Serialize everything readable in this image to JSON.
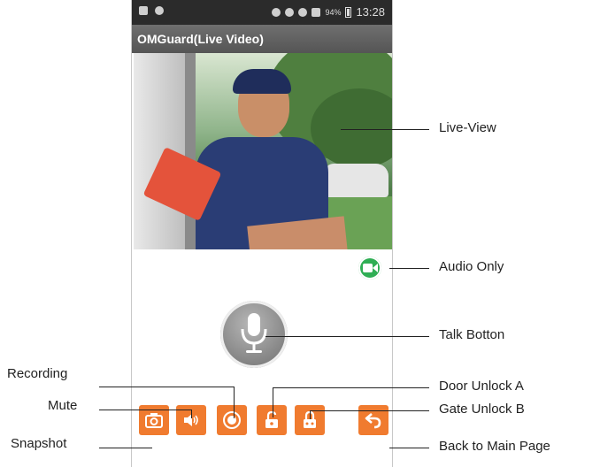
{
  "status_bar": {
    "battery_pct": "94%",
    "time": "13:28"
  },
  "app": {
    "title": "OMGuard(Live Video)"
  },
  "callouts": {
    "live_view": "Live-View",
    "audio_only": "Audio Only",
    "talk": "Talk Botton",
    "door_unlock": "Door Unlock A",
    "gate_unlock": "Gate Unlock B",
    "back": "Back to Main Page",
    "recording": "Recording",
    "mute": "Mute",
    "snapshot": "Snapshot"
  },
  "icons": {
    "audio_only": "video-camera-icon",
    "talk": "microphone-icon",
    "snapshot": "camera-icon",
    "mute": "speaker-icon",
    "recording": "record-icon",
    "door_unlock": "unlock-icon",
    "gate_unlock": "lock-icon",
    "back": "back-arrow-icon"
  },
  "colors": {
    "action_orange": "#f07b2f",
    "audio_green": "#2fae54",
    "title_bar": "#5a5a5a"
  }
}
